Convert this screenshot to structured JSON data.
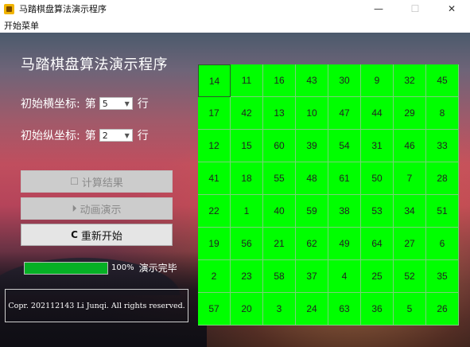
{
  "window": {
    "title": "马踏棋盘算法演示程序",
    "controls": {
      "minimize": "—",
      "maximize": "☐",
      "close": "✕"
    }
  },
  "menubar": {
    "items": [
      "开始菜单"
    ]
  },
  "panel": {
    "heading": "马踏棋盘算法演示程序",
    "row_coord": {
      "label": "初始横坐标:",
      "prefix": "第",
      "value": "5",
      "suffix": "行"
    },
    "col_coord": {
      "label": "初始纵坐标:",
      "prefix": "第",
      "value": "2",
      "suffix": "行"
    },
    "buttons": {
      "compute": {
        "label": "计算结果",
        "icon": "checkbox-icon",
        "enabled": false
      },
      "animate": {
        "label": "动画演示",
        "icon": "play-circle-icon",
        "enabled": false
      },
      "restart": {
        "label": "重新开始",
        "icon": "refresh-icon",
        "enabled": true
      }
    },
    "progress": {
      "percent_text": "100%",
      "fraction": 1.0,
      "status": "演示完毕",
      "color": "#06b025"
    },
    "copyright": "Copr. 202112143 Li Junqi. All rights reserved."
  },
  "board": {
    "color": "#00ff00",
    "start_cell": [
      0,
      0
    ],
    "rows": [
      [
        14,
        11,
        16,
        43,
        30,
        9,
        32,
        45
      ],
      [
        17,
        42,
        13,
        10,
        47,
        44,
        29,
        8
      ],
      [
        12,
        15,
        60,
        39,
        54,
        31,
        46,
        33
      ],
      [
        41,
        18,
        55,
        48,
        61,
        50,
        7,
        28
      ],
      [
        22,
        1,
        40,
        59,
        38,
        53,
        34,
        51
      ],
      [
        19,
        56,
        21,
        62,
        49,
        64,
        27,
        6
      ],
      [
        2,
        23,
        58,
        37,
        4,
        25,
        52,
        35
      ],
      [
        57,
        20,
        3,
        24,
        63,
        36,
        5,
        26
      ]
    ]
  }
}
